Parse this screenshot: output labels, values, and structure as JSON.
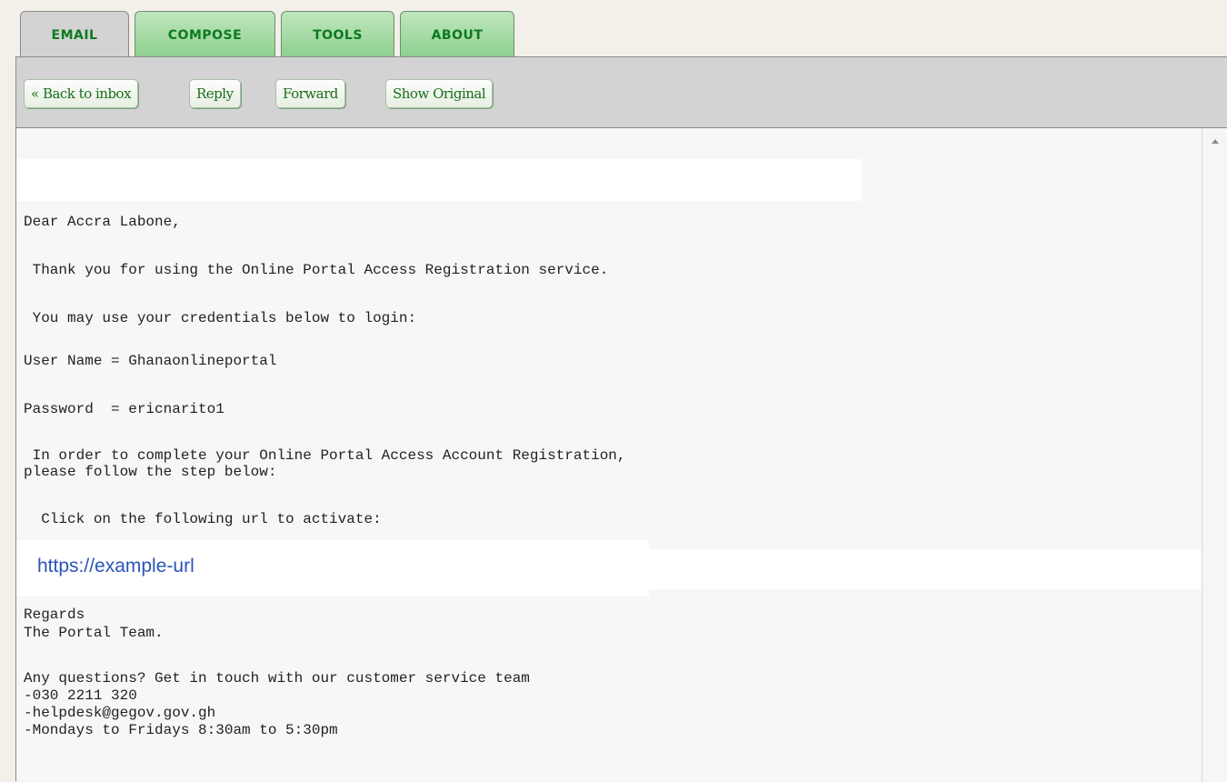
{
  "tabs": [
    {
      "label": "EMAIL",
      "active": true
    },
    {
      "label": "COMPOSE",
      "active": false
    },
    {
      "label": "TOOLS",
      "active": false
    },
    {
      "label": "ABOUT",
      "active": false
    }
  ],
  "toolbar": {
    "back_label": "« Back to inbox",
    "reply_label": "Reply",
    "forward_label": "Forward",
    "show_original_label": "Show Original"
  },
  "email": {
    "greeting": "Dear Accra Labone,",
    "thanks": " Thank you for using the Online Portal Access Registration service.",
    "credentials_intro": " You may use your credentials below to login:",
    "username_line": "User Name = Ghanaonlineportal",
    "password_line": "Password  = ericnarito1",
    "instructions_1": " In order to complete your Online Portal Access Account Registration,",
    "instructions_2": "please follow the step below:",
    "click_line": "  Click on the following url to activate:",
    "url": "https://example-url",
    "regards": "Regards",
    "team": "The Portal Team.",
    "questions": "Any questions? Get in touch with our customer service team",
    "phone": "-030 2211 320",
    "helpdesk": "-helpdesk@gegov.gov.gh",
    "hours": "-Mondays to Fridays 8:30am to 5:30pm"
  },
  "colors": {
    "tab_text": "#0d7a1f",
    "toolbar_bg": "#d3d3d3",
    "button_text": "#1a6d1a",
    "link": "#2a55b8"
  }
}
